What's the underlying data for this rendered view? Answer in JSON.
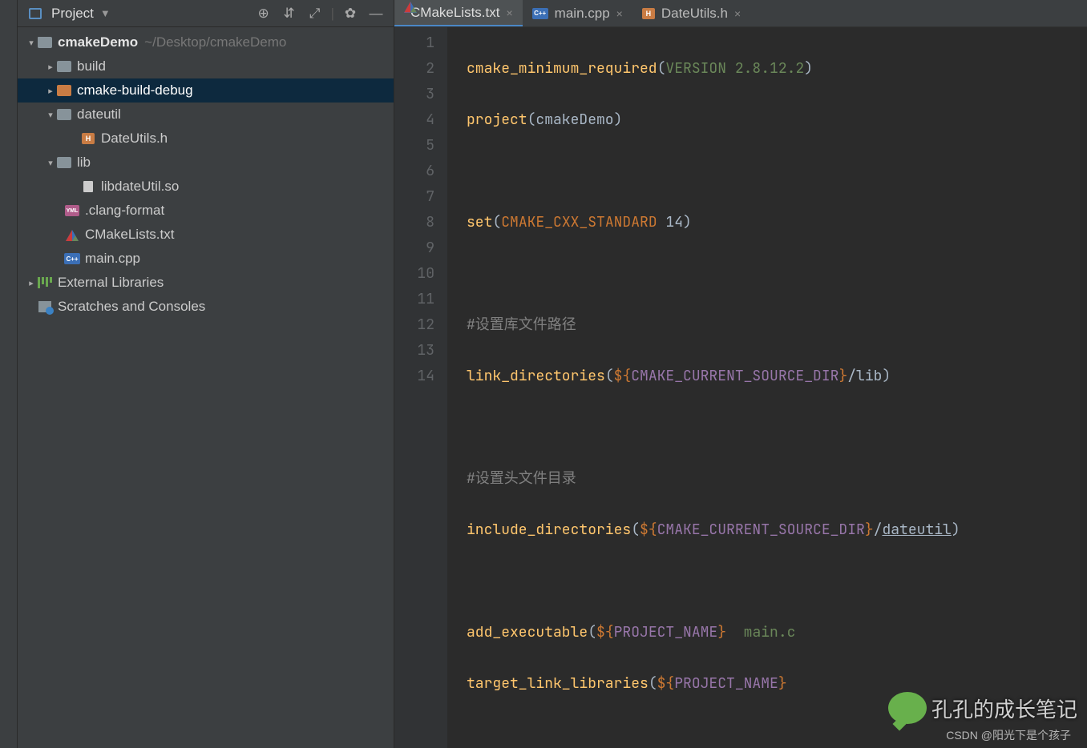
{
  "project_panel": {
    "title": "Project",
    "root": {
      "name": "cmakeDemo",
      "path": "~/Desktop/cmakeDemo"
    },
    "nodes": [
      {
        "label": "build"
      },
      {
        "label": "cmake-build-debug"
      },
      {
        "label": "dateutil"
      },
      {
        "label": "DateUtils.h"
      },
      {
        "label": "lib"
      },
      {
        "label": "libdateUtil.so"
      },
      {
        "label": ".clang-format"
      },
      {
        "label": "CMakeLists.txt"
      },
      {
        "label": "main.cpp"
      },
      {
        "label": "External Libraries"
      },
      {
        "label": "Scratches and Consoles"
      }
    ]
  },
  "tabs": [
    {
      "label": "CMakeLists.txt",
      "active": true
    },
    {
      "label": "main.cpp",
      "active": false
    },
    {
      "label": "DateUtils.h",
      "active": false
    }
  ],
  "editor": {
    "lines": [
      "1",
      "2",
      "3",
      "4",
      "5",
      "6",
      "7",
      "8",
      "9",
      "10",
      "11",
      "12",
      "13",
      "14"
    ],
    "code": {
      "l1a": "cmake_minimum_required",
      "l1b": "(",
      "l1c": "VERSION 2.8.12.2",
      "l1d": ")",
      "l2a": "project",
      "l2b": "(cmakeDemo)",
      "l4a": "set",
      "l4b": "(",
      "l4c": "CMAKE_CXX_STANDARD",
      "l4d": " 14",
      "l4e": ")",
      "l6": "#设置库文件路径",
      "l7a": "link_directories",
      "l7b": "(",
      "l7c": "${",
      "l7d": "CMAKE_CURRENT_SOURCE_DIR",
      "l7e": "}",
      "l7f": "/lib)",
      "l9": "#设置头文件目录",
      "l10a": "include_directories",
      "l10b": "(",
      "l10c": "${",
      "l10d": "CMAKE_CURRENT_SOURCE_DIR",
      "l10e": "}",
      "l10f": "/",
      "l10g": "dateutil",
      "l10h": ")",
      "l12a": "add_executable",
      "l12b": "(",
      "l12c": "${",
      "l12d": "PROJECT_NAME",
      "l12e": "}",
      "l12f": "  main.c",
      "l13a": "target_link_libraries",
      "l13b": "(",
      "l13c": "${",
      "l13d": "PROJECT_NAME",
      "l13e": "}"
    }
  },
  "watermark": {
    "brand": "孔孔的成长笔记",
    "csdn": "CSDN @阳光下是个孩子"
  }
}
